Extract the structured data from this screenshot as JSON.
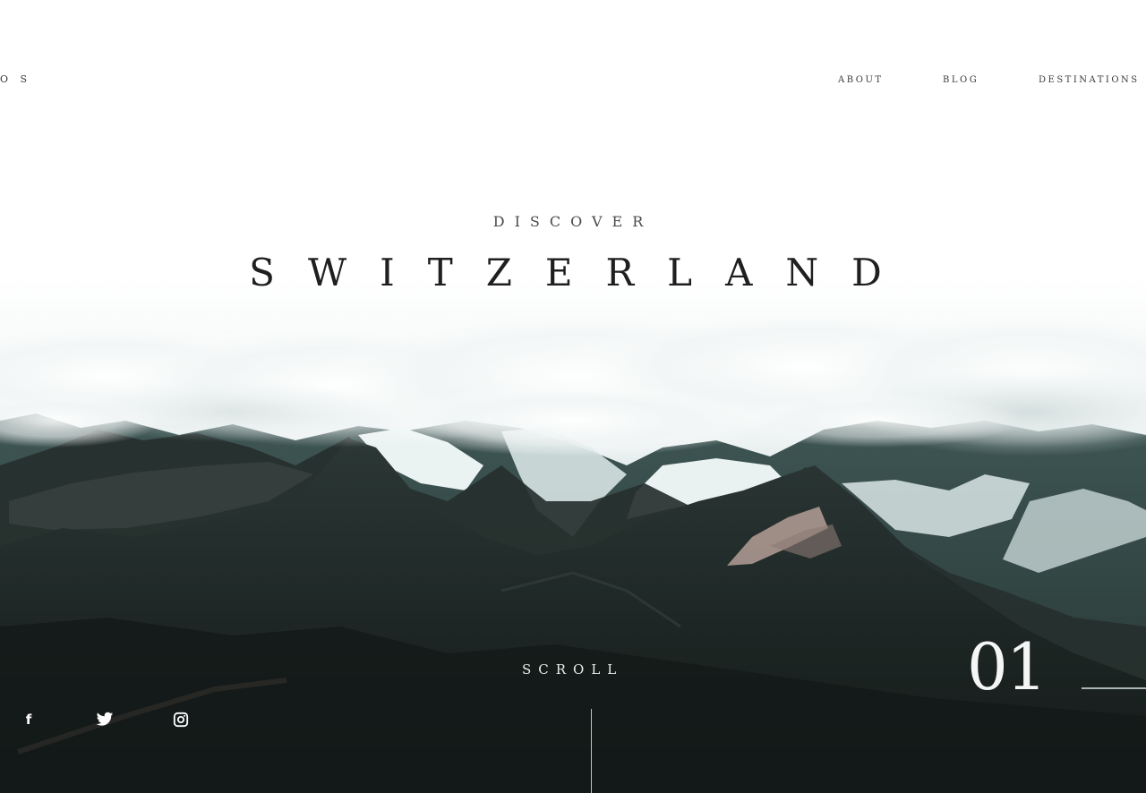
{
  "brand": {
    "logo_text": "O S"
  },
  "nav": {
    "items": [
      {
        "label": "ABOUT"
      },
      {
        "label": "BLOG"
      },
      {
        "label": "DESTINATIONS"
      }
    ]
  },
  "hero": {
    "eyebrow": "DISCOVER",
    "title": "SWITZERLAND",
    "scroll_label": "SCROLL",
    "slide_number": "01"
  },
  "social": {
    "facebook_glyph": "f",
    "icons": [
      "facebook-icon",
      "twitter-icon",
      "instagram-icon"
    ]
  },
  "colors": {
    "text_dark": "#1f1f1f",
    "fog": "#e7eeee",
    "mountain_dark": "#1c2422",
    "snow": "#e9f1f1"
  }
}
